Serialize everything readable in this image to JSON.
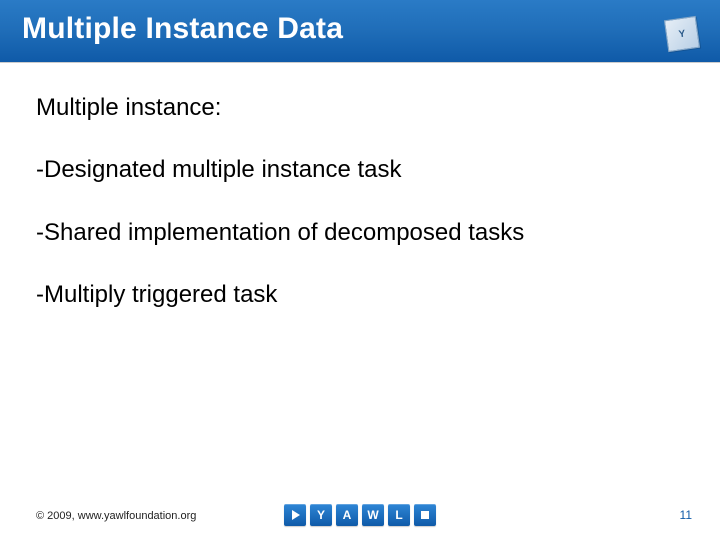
{
  "header": {
    "title": "Multiple Instance Data",
    "logo_label": "Y"
  },
  "content": {
    "heading": "Multiple instance:",
    "bullets": [
      "-Designated multiple instance task",
      "-Shared implementation of decomposed tasks",
      "-Multiply triggered task"
    ]
  },
  "footer": {
    "copyright": "© 2009, www.yawlfoundation.org",
    "page_number": "11",
    "logo_letters": [
      "Y",
      "A",
      "W",
      "L"
    ]
  }
}
